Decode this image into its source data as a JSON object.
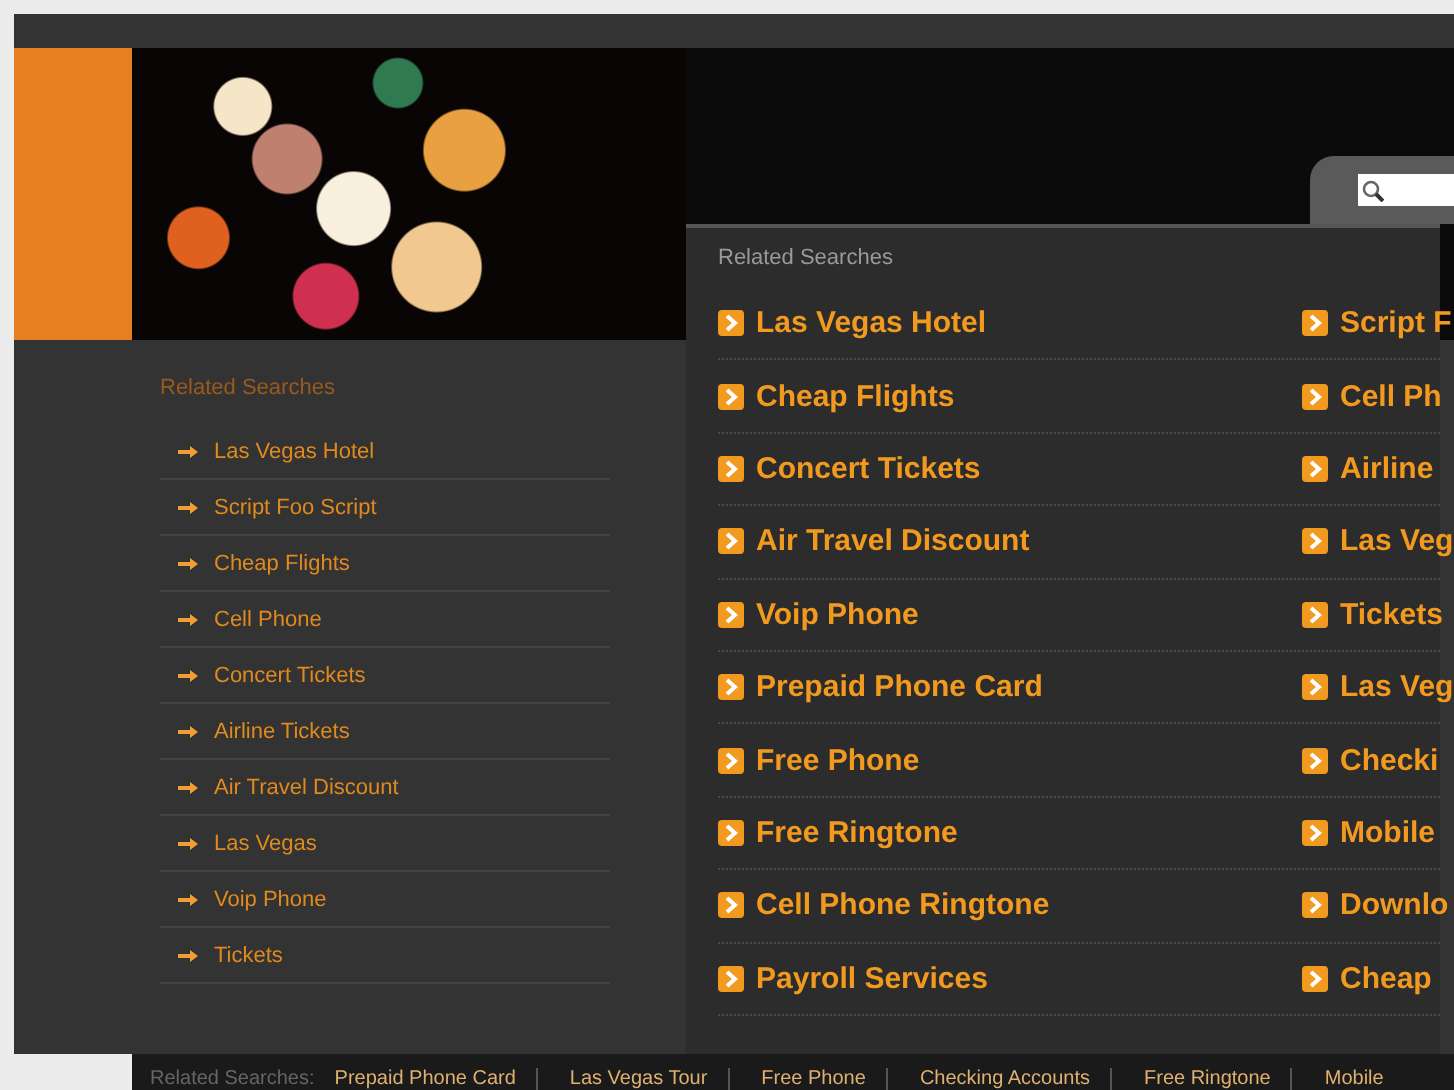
{
  "sidebar": {
    "title": "Related Searches",
    "items": [
      "Las Vegas Hotel",
      "Script Foo Script",
      "Cheap Flights",
      "Cell Phone",
      "Concert Tickets",
      "Airline Tickets",
      "Air Travel Discount",
      "Las Vegas",
      "Voip Phone",
      "Tickets"
    ]
  },
  "main": {
    "title": "Related Searches",
    "rows": [
      {
        "left": "Las Vegas Hotel",
        "right": "Script F"
      },
      {
        "left": "Cheap Flights",
        "right": "Cell Ph"
      },
      {
        "left": "Concert Tickets",
        "right": "Airline"
      },
      {
        "left": "Air Travel Discount",
        "right": "Las Veg"
      },
      {
        "left": "Voip Phone",
        "right": "Tickets"
      },
      {
        "left": "Prepaid Phone Card",
        "right": "Las Veg"
      },
      {
        "left": "Free Phone",
        "right": "Checki"
      },
      {
        "left": "Free Ringtone",
        "right": "Mobile"
      },
      {
        "left": "Cell Phone Ringtone",
        "right": "Downlo"
      },
      {
        "left": "Payroll Services",
        "right": "Cheap"
      }
    ]
  },
  "footer": {
    "label": "Related Searches:",
    "links": [
      "Prepaid Phone Card",
      "Las Vegas Tour",
      "Free Phone",
      "Checking Accounts",
      "Free Ringtone",
      "Mobile"
    ]
  }
}
